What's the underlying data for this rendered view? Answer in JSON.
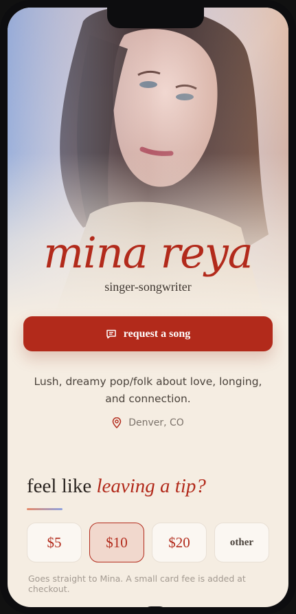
{
  "artist": {
    "name": "mina reya",
    "subtitle": "singer-songwriter",
    "bio": "Lush, dreamy pop/folk about love, longing, and connection.",
    "location": "Denver, CO"
  },
  "actions": {
    "request_label": "request a song"
  },
  "tips": {
    "heading_plain": "feel like ",
    "heading_accent": "leaving a tip?",
    "options": [
      "$5",
      "$10",
      "$20",
      "other"
    ],
    "selected": "$10",
    "note": "Goes straight to Mina. A small card fee is added at checkout."
  },
  "colors": {
    "accent": "#b22a1b",
    "background": "#f5ede2",
    "selected_tip_bg": "#f1d8cd"
  },
  "icons": {
    "request": "message-icon",
    "location": "map-pin-icon"
  }
}
